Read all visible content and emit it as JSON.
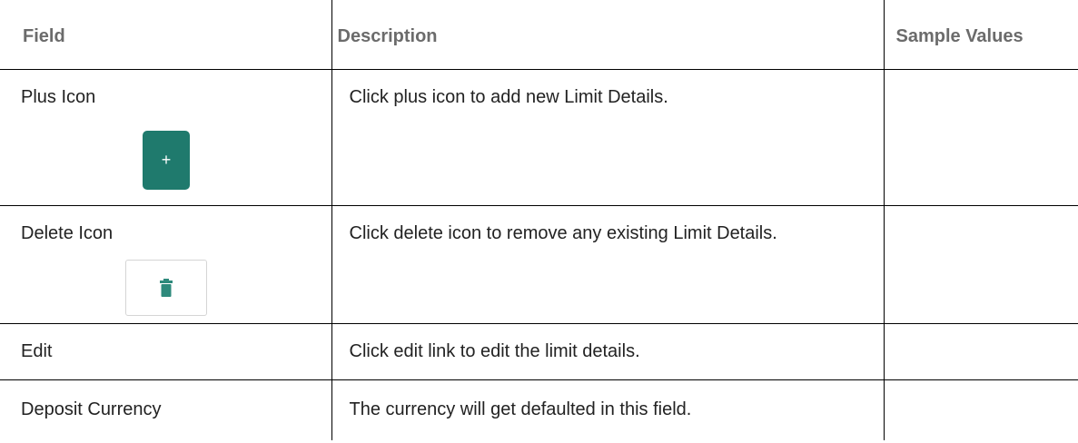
{
  "table": {
    "headers": [
      "Field",
      "Description",
      "Sample Values"
    ],
    "rows": [
      {
        "field": "Plus Icon",
        "description": "Click plus icon to add new Limit Details.",
        "sample": ""
      },
      {
        "field": "Delete Icon",
        "description": "Click delete icon to remove any existing Limit Details.",
        "sample": ""
      },
      {
        "field": "Edit",
        "description": "Click edit link to edit the limit details.",
        "sample": ""
      },
      {
        "field": "Deposit Currency",
        "description": "The currency will get defaulted in this field.",
        "sample": ""
      }
    ]
  },
  "icons": {
    "plus_button_glyph": "+",
    "plus_button_color": "#1f7a6d",
    "trash_icon_color": "#2e8a7c"
  }
}
